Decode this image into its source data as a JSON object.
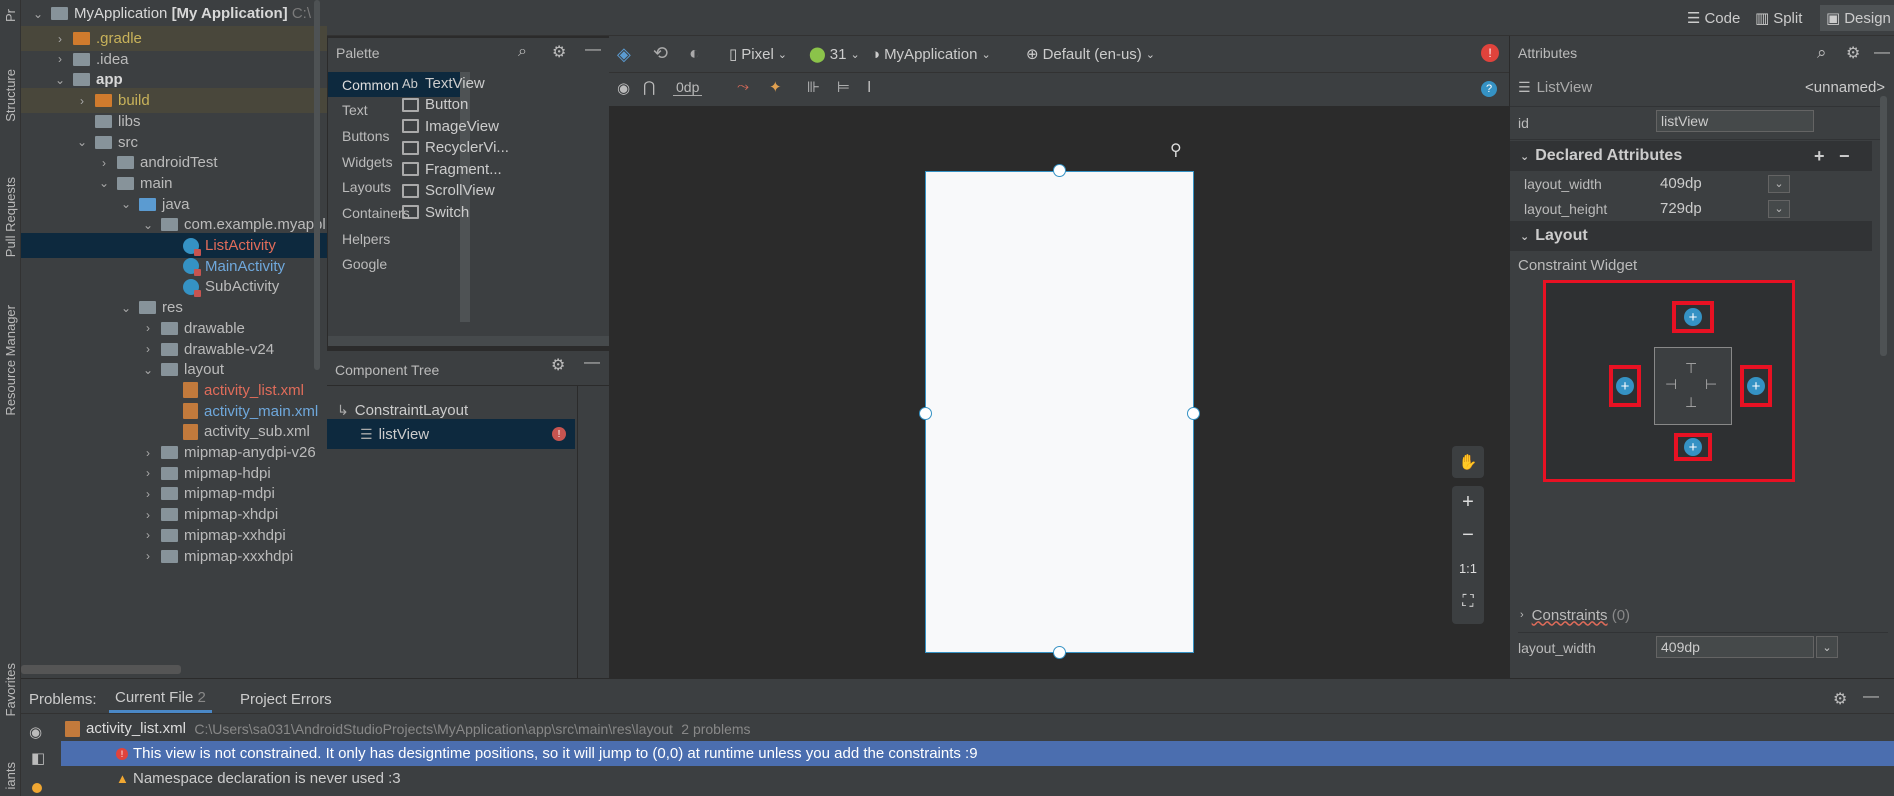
{
  "left_strip": {
    "project": "Pr",
    "structure": "Structure",
    "pull_requests": "Pull Requests",
    "resource_manager": "Resource Manager",
    "favorites": "Favorites",
    "variants": "iants"
  },
  "project_tree": {
    "root": {
      "name": "MyApplication",
      "bold": "[My Application]",
      "path": "C:\\"
    },
    "rows": [
      {
        "label": ".gradle"
      },
      {
        "label": ".idea"
      },
      {
        "label": "app"
      },
      {
        "label": "build"
      },
      {
        "label": "libs"
      },
      {
        "label": "src"
      },
      {
        "label": "androidTest"
      },
      {
        "label": "main"
      },
      {
        "label": "java"
      },
      {
        "label": "com.example.myappl"
      },
      {
        "label": "ListActivity"
      },
      {
        "label": "MainActivity"
      },
      {
        "label": "SubActivity"
      },
      {
        "label": "res"
      },
      {
        "label": "drawable"
      },
      {
        "label": "drawable-v24"
      },
      {
        "label": "layout"
      },
      {
        "label": "activity_list.xml"
      },
      {
        "label": "activity_main.xml"
      },
      {
        "label": "activity_sub.xml"
      },
      {
        "label": "mipmap-anydpi-v26"
      },
      {
        "label": "mipmap-hdpi"
      },
      {
        "label": "mipmap-mdpi"
      },
      {
        "label": "mipmap-xhdpi"
      },
      {
        "label": "mipmap-xxhdpi"
      },
      {
        "label": "mipmap-xxxhdpi"
      }
    ]
  },
  "view_modes": {
    "code": "Code",
    "split": "Split",
    "design": "Design"
  },
  "palette": {
    "title": "Palette",
    "categories": [
      "Common",
      "Text",
      "Buttons",
      "Widgets",
      "Layouts",
      "Containers",
      "Helpers",
      "Google"
    ],
    "items": [
      "TextView",
      "Button",
      "ImageView",
      "RecyclerVi...",
      "Fragment...",
      "ScrollView",
      "Switch"
    ],
    "textview_icon_text": "Ab"
  },
  "component_tree": {
    "title": "Component Tree",
    "root": "ConstraintLayout",
    "child": "listView"
  },
  "design_toolbar": {
    "device": "Pixel",
    "api": "31",
    "theme": "MyApplication",
    "locale": "Default (en-us)",
    "margin": "0dp"
  },
  "zoom": {
    "one_to_one": "1:1"
  },
  "attributes": {
    "title": "Attributes",
    "widget": "ListView",
    "unnamed": "<unnamed>",
    "id_label": "id",
    "id_value": "listView",
    "declared_title": "Declared Attributes",
    "declared": [
      {
        "name": "layout_width",
        "value": "409dp"
      },
      {
        "name": "layout_height",
        "value": "729dp"
      },
      {
        "name": "id",
        "value": "listView"
      }
    ],
    "layout_title": "Layout",
    "constraint_widget": "Constraint Widget",
    "constraints_label": "Constraints",
    "constraints_count": "(0)",
    "bottom_label": "layout_width",
    "bottom_value": "409dp"
  },
  "problems": {
    "label": "Problems:",
    "tabs": [
      {
        "label": "Current File",
        "count": "2"
      },
      {
        "label": "Project Errors"
      }
    ],
    "file": "activity_list.xml",
    "path": "C:\\Users\\sa031\\AndroidStudioProjects\\MyApplication\\app\\src\\main\\res\\layout",
    "count": "2 problems",
    "items": [
      {
        "text": "This view is not constrained. It only has designtime positions, so it will jump to (0,0) at runtime unless you add the constraints :9"
      },
      {
        "text": "Namespace declaration is never used :3"
      }
    ]
  },
  "colors": {
    "accent": "#4b6eaf",
    "highlight_red": "#e81123",
    "selection": "#0d293e"
  }
}
